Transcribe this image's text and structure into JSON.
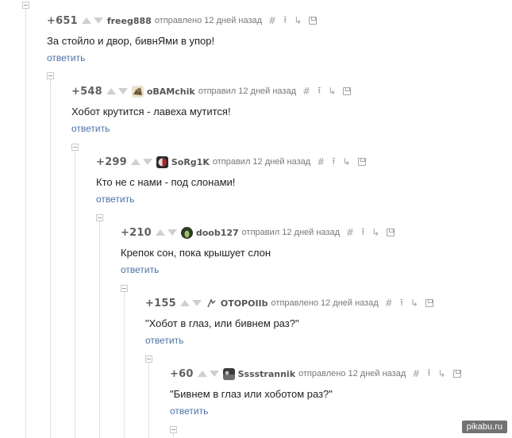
{
  "comments": [
    {
      "rating": "+651",
      "author": "freeg888",
      "posted": "отправлено 12 дней назад",
      "text": "За стойло и двор, бивнЯми в упор!",
      "reply": "ответить"
    },
    {
      "rating": "+548",
      "author": "oBAMchik",
      "posted": "отправил 12 дней назад",
      "text": "Хобот крутится - лавеха мутится!",
      "reply": "ответить"
    },
    {
      "rating": "+299",
      "author": "SoRg1K",
      "posted": "отправил 12 дней назад",
      "text": "Кто не с нами - под слонами!",
      "reply": "ответить"
    },
    {
      "rating": "+210",
      "author": "doob127",
      "posted": "отправил 12 дней назад",
      "text": "Крепок сон, пока крышует слон",
      "reply": "ответить"
    },
    {
      "rating": "+155",
      "author": "OTOPOIIb",
      "posted": "отправлено 12 дней назад",
      "text": "\"Хобот в глаз, или бивнем раз?\"",
      "reply": "ответить"
    },
    {
      "rating": "+60",
      "author": "Sssstrannik",
      "posted": "отправлено 12 дней назад",
      "text": "\"Бивнем в глаз или хоботом раз?\"",
      "reply": "ответить"
    }
  ],
  "tools": {
    "link": "#",
    "parent": "⭱",
    "branch": "↳"
  },
  "watermark": "pikabu.ru",
  "colors": {
    "reply_link": "#4a72a6",
    "rating": "#616161",
    "thread_line": "#e1e1e1"
  }
}
